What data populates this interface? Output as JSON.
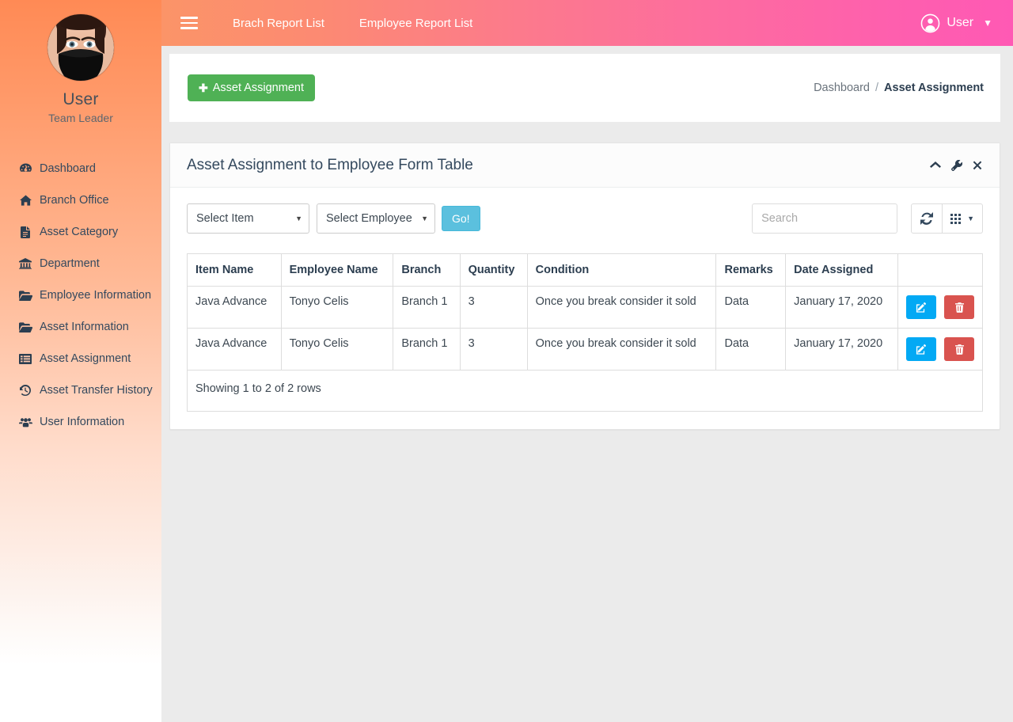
{
  "sidebar": {
    "profile": {
      "name": "User",
      "role": "Team Leader",
      "avatar_icon": "user-avatar-photo"
    },
    "items": [
      {
        "label": "Dashboard",
        "icon": "dashboard-icon"
      },
      {
        "label": "Branch Office",
        "icon": "home-icon"
      },
      {
        "label": "Asset Category",
        "icon": "file-text-icon"
      },
      {
        "label": "Department",
        "icon": "bank-icon"
      },
      {
        "label": "Employee Information",
        "icon": "folder-open-icon"
      },
      {
        "label": "Asset Information",
        "icon": "folder-open-icon"
      },
      {
        "label": "Asset Assignment",
        "icon": "list-alt-icon"
      },
      {
        "label": "Asset Transfer History",
        "icon": "history-icon"
      },
      {
        "label": "User Information",
        "icon": "users-icon"
      }
    ]
  },
  "navbar": {
    "toggle_icon": "hamburger-icon",
    "links": [
      {
        "label": "Brach Report List"
      },
      {
        "label": "Employee Report List"
      }
    ],
    "user": {
      "icon": "user-circle-icon",
      "label": "User",
      "caret": "⌄"
    },
    "gradient_from": "#fb9468",
    "gradient_to": "#ff59b4"
  },
  "toolbar": {
    "add_button": {
      "label": "Asset Assignment",
      "icon": "plus-icon",
      "color": "#4fb155"
    }
  },
  "breadcrumb": {
    "root": "Dashboard",
    "separator": "/",
    "current": "Asset Assignment"
  },
  "panel": {
    "title": "Asset Assignment to Employee Form Table",
    "tools": [
      {
        "icon": "chevron-up-icon",
        "name": "collapse"
      },
      {
        "icon": "wrench-icon",
        "name": "settings"
      },
      {
        "icon": "close-icon",
        "name": "close"
      }
    ]
  },
  "filters": {
    "select_item": {
      "selected": "Select Item",
      "options": [
        "Select Item"
      ]
    },
    "select_employee": {
      "selected": "Select Employee",
      "options": [
        "Select Employee"
      ]
    },
    "go_button": {
      "label": "Go!",
      "color": "#5bc0de"
    },
    "search": {
      "value": "",
      "placeholder": "Search"
    },
    "refresh_icon": "refresh-icon",
    "columns_icon": "grid-icon"
  },
  "table": {
    "columns": [
      "Item Name",
      "Employee Name",
      "Branch",
      "Quantity",
      "Condition",
      "Remarks",
      "Date Assigned",
      ""
    ],
    "rows": [
      {
        "item_name": "Java Advance",
        "employee_name": "Tonyo Celis",
        "branch": "Branch 1",
        "quantity": "3",
        "condition": "Once you break consider it sold",
        "remarks": "Data",
        "date_assigned": "January 17, 2020"
      },
      {
        "item_name": "Java Advance",
        "employee_name": "Tonyo Celis",
        "branch": "Branch 1",
        "quantity": "3",
        "condition": "Once you break consider it sold",
        "remarks": "Data",
        "date_assigned": "January 17, 2020"
      }
    ],
    "row_actions": {
      "edit_icon": "edit-pencil-icon",
      "delete_icon": "trash-icon"
    },
    "footer_text": "Showing 1 to 2 of 2 rows"
  }
}
